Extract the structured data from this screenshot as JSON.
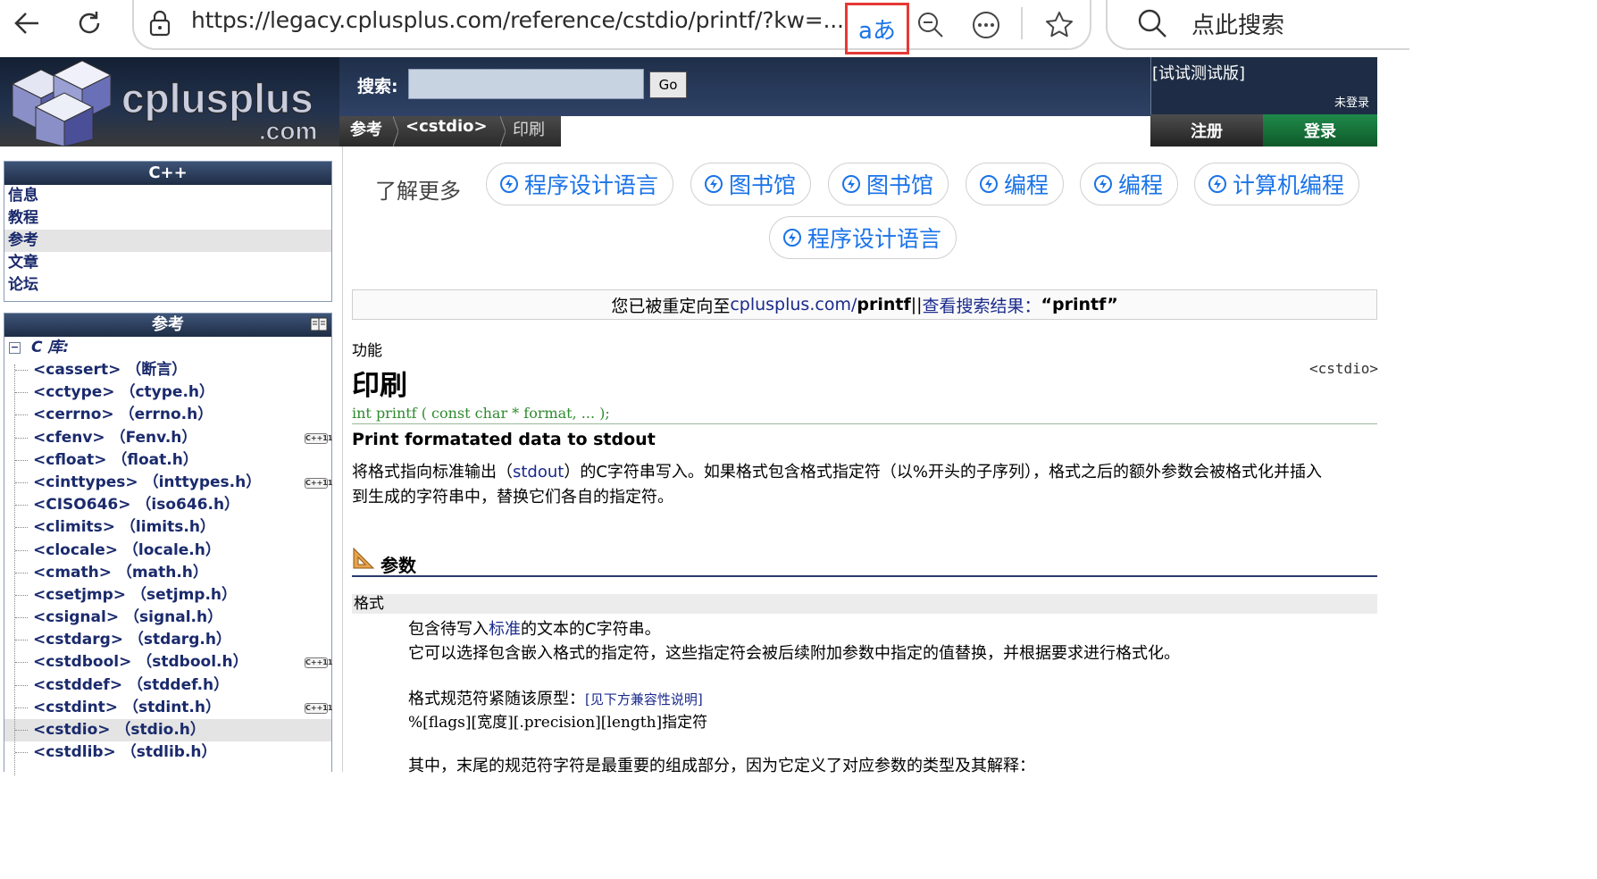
{
  "browser": {
    "url": "https://legacy.cplusplus.com/reference/cstdio/printf/?kw=...",
    "translate_label": "aあ",
    "search_placeholder": "点此搜索"
  },
  "site": {
    "logo_text": "cplusplus",
    "logo_domain": ".com",
    "search_label": "搜索:",
    "go_label": "Go",
    "trial_label": "[试试测试版]",
    "login_status": "未登录",
    "register_label": "注册",
    "login_label": "登录",
    "breadcrumb": [
      "参考",
      "<cstdio>",
      "印刷"
    ]
  },
  "sidebar": {
    "cpp_title": "C++",
    "cpp_items": [
      {
        "label": "信息"
      },
      {
        "label": "教程"
      },
      {
        "label": "参考"
      },
      {
        "label": "文章"
      },
      {
        "label": "论坛"
      }
    ],
    "ref_title": "参考",
    "ref_root": "C 库:",
    "ref_items": [
      {
        "label": "<cassert> （断言）",
        "cpp11": ""
      },
      {
        "label": "<cctype> （ctype.h）",
        "cpp11": ""
      },
      {
        "label": "<cerrno> （errno.h）",
        "cpp11": ""
      },
      {
        "label": "<cfenv> （Fenv.h）",
        "cpp11": "C++11"
      },
      {
        "label": "<cfloat> （float.h）",
        "cpp11": ""
      },
      {
        "label": "<cinttypes> （inttypes.h）",
        "cpp11": "C++11"
      },
      {
        "label": "<CISO646> （iso646.h）",
        "cpp11": ""
      },
      {
        "label": "<climits> （limits.h）",
        "cpp11": ""
      },
      {
        "label": "<clocale> （locale.h）",
        "cpp11": ""
      },
      {
        "label": "<cmath> （math.h）",
        "cpp11": ""
      },
      {
        "label": "<csetjmp> （setjmp.h）",
        "cpp11": ""
      },
      {
        "label": "<csignal> （signal.h）",
        "cpp11": ""
      },
      {
        "label": "<cstdarg> （stdarg.h）",
        "cpp11": ""
      },
      {
        "label": "<cstdbool> （stdbool.h）",
        "cpp11": "C++11"
      },
      {
        "label": "<cstddef> （stddef.h）",
        "cpp11": ""
      },
      {
        "label": "<cstdint> （stdint.h）",
        "cpp11": "C++11"
      },
      {
        "label": "<cstdio> （stdio.h）",
        "cpp11": ""
      },
      {
        "label": "<cstdlib> （stdlib.h）",
        "cpp11": ""
      }
    ]
  },
  "learn_more": {
    "label": "了解更多",
    "chips": [
      "程序设计语言",
      "图书馆",
      "图书馆",
      "编程",
      "编程",
      "计算机编程",
      "程序设计语言"
    ]
  },
  "redirect": {
    "prefix": "您已被重定向至 ",
    "link": "cplusplus.com/",
    "bold": " printf",
    "sep": " ||",
    "search_link": "查看搜索结果：",
    "search_term": "“printf”"
  },
  "article": {
    "kind": "功能",
    "title": "印刷",
    "header": "<cstdio>",
    "prototype": "int printf ( const char * format, ... );",
    "summary": "Print formatated data to stdout",
    "desc_1a": "将格式指向标准输出（",
    "desc_link": "stdout",
    "desc_1b": "）的C字符串写入。如果格式包含格式指定符（以%开头的子序列），格式之后的额外参数会被格式化并插入",
    "desc_2": "到生成的字符串中，替换它们各自的指定符。",
    "params_title": "参数",
    "param_name": "格式",
    "p1a": "包含待写入",
    "p1_link": "标准",
    "p1b": "的文本的C字符串。",
    "p2": "它可以选择包含嵌入格式的指定符，这些指定符会被后续附加参数中指定的值替换，并根据要求进行格式化。",
    "p3a": "格式规范符紧随该原型：",
    "p3_link": "[见下方兼容性说明]",
    "p4": "%[flags][宽度][.precision][length]指定符",
    "p5": "其中，末尾的规范符字符是最重要的组成部分，因为它定义了对应参数的类型及其解释："
  },
  "colors": {
    "nav_dark": "#1e2d45",
    "link": "#1a73e8",
    "login_green": "#1f8a4a",
    "highlight_red": "#e53935"
  }
}
